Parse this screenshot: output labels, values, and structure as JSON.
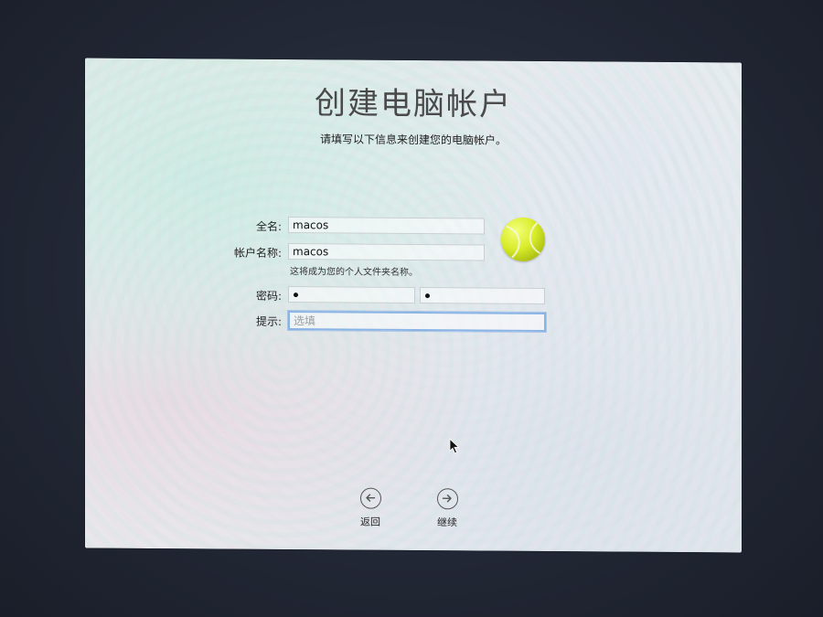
{
  "page": {
    "title": "创建电脑帐户",
    "subtitle": "请填写以下信息来创建您的电脑帐户。"
  },
  "form": {
    "full_name_label": "全名:",
    "full_name_value": "macos",
    "account_name_label": "帐户名称:",
    "account_name_value": "macos",
    "account_name_hint": "这将成为您的个人文件夹名称。",
    "password_label": "密码:",
    "password_value": "•",
    "verify_value": "•",
    "hint_label": "提示:",
    "hint_placeholder": "选填"
  },
  "avatar": {
    "icon": "tennis-ball-icon"
  },
  "navigation": {
    "back_label": "返回",
    "back_icon": "arrow-left-circle-icon",
    "continue_label": "继续",
    "continue_icon": "arrow-right-circle-icon"
  },
  "colors": {
    "focus_ring": "#8bb4e6",
    "tennis_ball": "#d9ec2a"
  }
}
